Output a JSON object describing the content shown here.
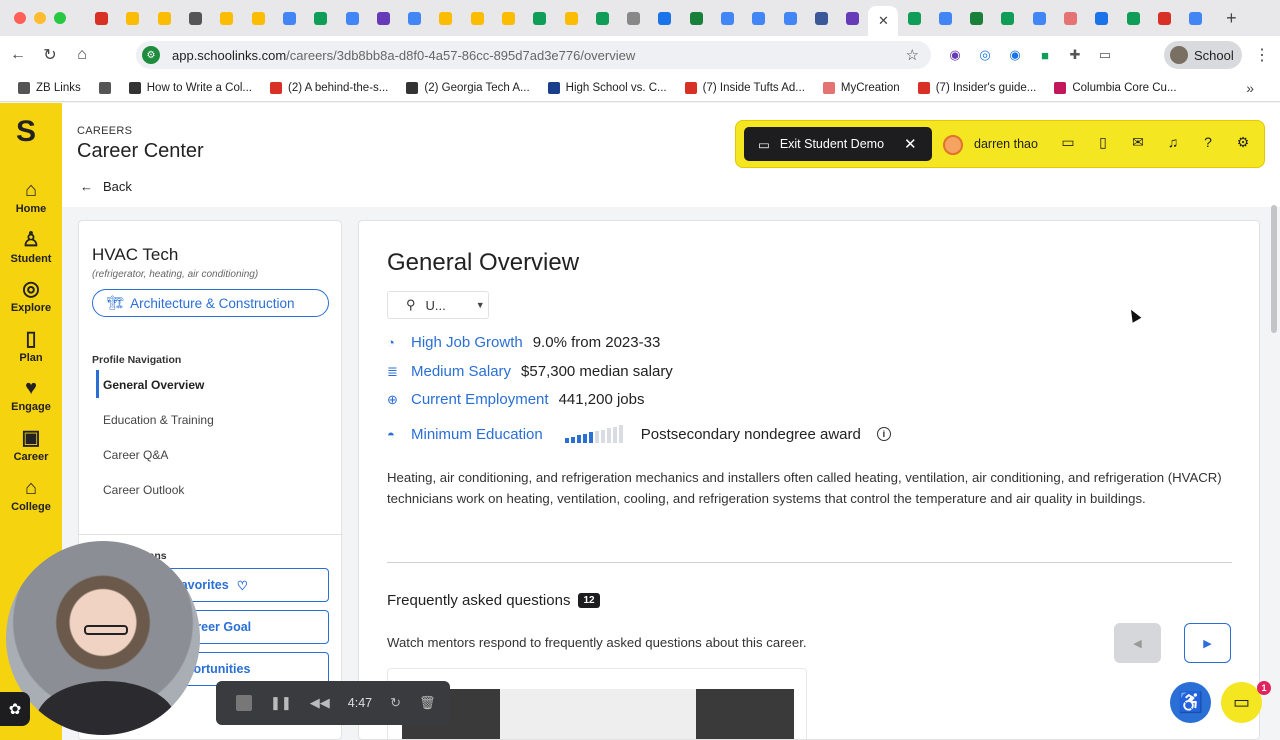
{
  "browser": {
    "tab_colors": [
      "#d93025",
      "#fbbc04",
      "#fbbc04",
      "#555555",
      "#fbbc04",
      "#fbbc04",
      "#4285f4",
      "#0f9d58",
      "#4285f4",
      "#673ab7",
      "#4285f4",
      "#fbbc04",
      "#fbbc04",
      "#fbbc04",
      "#0f9d58",
      "#fbbc04",
      "#0f9d58",
      "#888888",
      "#1a73e8",
      "#188038",
      "#4285f4",
      "#4285f4",
      "#4285f4",
      "#3b5998",
      "#673ab7"
    ],
    "active_tab_close": "✕",
    "tab_colors_after": [
      "#0f9d58",
      "#4285f4",
      "#188038",
      "#0f9d58",
      "#4285f4",
      "#e57373",
      "#1a73e8",
      "#0f9d58",
      "#d93025",
      "#4285f4"
    ],
    "new_tab": "+",
    "url_host": "app.schoolinks.com",
    "url_path": "/careers/3db8bb8a-d8f0-4a57-86cc-895d7ad3e776/overview",
    "profile_label": "School",
    "bookmarks": [
      {
        "label": "ZB Links",
        "color": "#555555"
      },
      {
        "label": "",
        "color": "#555555"
      },
      {
        "label": "How to Write a Col...",
        "color": "#333333"
      },
      {
        "label": "(2) A behind-the-s...",
        "color": "#d93025"
      },
      {
        "label": "(2) Georgia Tech A...",
        "color": "#333333"
      },
      {
        "label": "High School vs. C...",
        "color": "#1a3e8c"
      },
      {
        "label": "(7) Inside Tufts Ad...",
        "color": "#d93025"
      },
      {
        "label": "MyCreation",
        "color": "#e57373"
      },
      {
        "label": "(7) Insider's guide...",
        "color": "#d93025"
      },
      {
        "label": "Columbia Core Cu...",
        "color": "#c2185b"
      }
    ],
    "bookmarks_more": "»"
  },
  "sidebar": {
    "items": [
      {
        "label": "Home",
        "icon": "⌂"
      },
      {
        "label": "Student",
        "icon": "♙"
      },
      {
        "label": "Explore",
        "icon": "◎"
      },
      {
        "label": "Plan",
        "icon": "▯"
      },
      {
        "label": "Engage",
        "icon": "♥"
      },
      {
        "label": "Career",
        "icon": "▣"
      },
      {
        "label": "College",
        "icon": "⌂"
      }
    ]
  },
  "header": {
    "crumb": "CAREERS",
    "title": "Career Center",
    "back_label": "Back",
    "exit_demo": "Exit Student Demo",
    "user_name": "darren thao"
  },
  "career": {
    "title": "HVAC Tech",
    "subtitle": "(refrigerator, heating, air conditioning)",
    "cluster": "Architecture & Construction",
    "profile_nav_label": "Profile Navigation",
    "nav": [
      "General Overview",
      "Education & Training",
      "Career Q&A",
      "Career Outlook"
    ],
    "actions_label": "ions",
    "actions": [
      "Favorites",
      "s Career Goal",
      "opportunities"
    ]
  },
  "overview": {
    "title": "General Overview",
    "location": "U...",
    "stats": [
      {
        "label": "High Job Growth",
        "value": "9.0% from 2023-33"
      },
      {
        "label": "Medium Salary",
        "value": "$57,300 median salary"
      },
      {
        "label": "Current Employment",
        "value": "441,200 jobs"
      },
      {
        "label": "Minimum Education",
        "value": "Postsecondary nondegree award"
      }
    ],
    "education_level": 0.5,
    "description": "Heating, air conditioning, and refrigeration mechanics and installers often called heating, ventilation, air conditioning, and refrigeration (HVACR) technicians work on heating, ventilation, cooling, and refrigeration systems that control the temperature and air quality in buildings.",
    "faq_title": "Frequently asked questions",
    "faq_count": "12",
    "faq_subtitle": "Watch mentors respond to frequently asked questions about this career."
  },
  "recorder": {
    "time": "4:47"
  },
  "chat_badge": "1",
  "colors": {
    "brand_yellow": "#f5d30f",
    "accent_blue": "#2a6fd6",
    "dark": "#1d1d1f"
  }
}
